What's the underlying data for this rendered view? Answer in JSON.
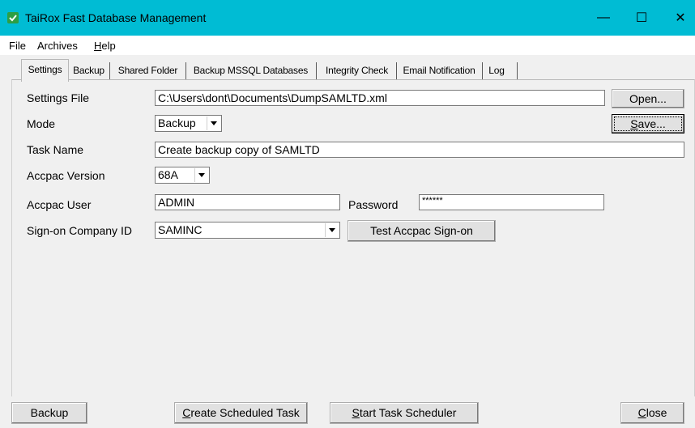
{
  "window": {
    "title": "TaiRox Fast Database Management",
    "minimize_glyph": "—",
    "maximize_glyph": "☐",
    "close_glyph": "✕",
    "titlebar_color": "#00bcd4"
  },
  "menu": {
    "file": "File",
    "archives": "Archives",
    "help_first": "H",
    "help_rest": "elp"
  },
  "tabs": [
    {
      "label": "Settings",
      "active": true
    },
    {
      "label": "Backup"
    },
    {
      "label": "Shared Folder"
    },
    {
      "label": "Backup MSSQL Databases"
    },
    {
      "label": "Integrity Check"
    },
    {
      "label": "Email Notification"
    },
    {
      "label": "Log"
    }
  ],
  "form": {
    "settings_file_label": "Settings File",
    "settings_file_value": "C:\\Users\\dont\\Documents\\DumpSAMLTD.xml",
    "open_button": "Open...",
    "mode_label": "Mode",
    "mode_value": "Backup",
    "save_first": "S",
    "save_rest": "ave...",
    "task_name_label": "Task Name",
    "task_name_value": "Create backup copy of SAMLTD",
    "accpac_version_label": "Accpac Version",
    "accpac_version_value": "68A",
    "accpac_user_label": "Accpac User",
    "accpac_user_value": "ADMIN",
    "password_label": "Password",
    "password_value": "******",
    "company_label": "Sign-on Company ID",
    "company_value": "SAMINC",
    "test_signon_button": "Test Accpac Sign-on"
  },
  "footer": {
    "backup_button": "Backup",
    "create_task_first": "C",
    "create_task_rest": "reate Scheduled Task",
    "start_scheduler_first": "S",
    "start_scheduler_rest": "tart Task Scheduler",
    "close_first": "C",
    "close_rest": "lose"
  }
}
